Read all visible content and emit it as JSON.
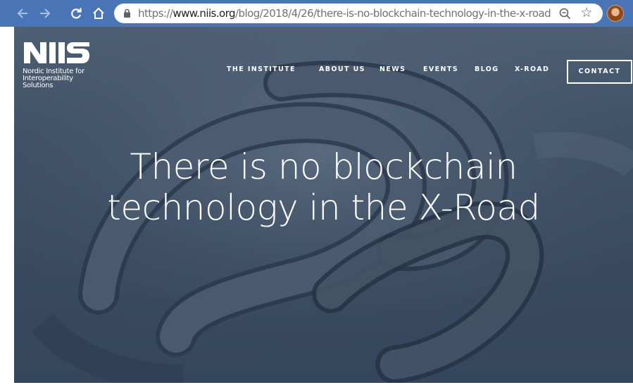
{
  "browser": {
    "back_icon": "arrow-left-icon",
    "forward_icon": "arrow-right-icon",
    "reload_icon": "reload-icon",
    "home_icon": "home-icon",
    "url_scheme": "https://",
    "url_host": "www.niis.org",
    "url_path": "/blog/2018/4/26/there-is-no-blockchain-technology-in-the-x-road",
    "zoom_icon": "zoom-icon",
    "star_icon": "star-icon",
    "avatar_icon": "profile-avatar"
  },
  "site": {
    "logo_text": "NIIS",
    "org_name_line1": "Nordic Institute for",
    "org_name_line2": "Interoperability",
    "org_name_line3": "Solutions",
    "nav": [
      {
        "label": "THE INSTITUTE"
      },
      {
        "label": "ABOUT US"
      },
      {
        "label": "NEWS"
      },
      {
        "label": "EVENTS"
      },
      {
        "label": "BLOG"
      },
      {
        "label": "X-ROAD"
      }
    ],
    "contact_label": "CONTACT"
  },
  "hero": {
    "title_line1": "There is no blockchain",
    "title_line2": "technology in the X-Road",
    "background": "chain-links-binary-image"
  },
  "colors": {
    "browser_bar": "#4a76b8",
    "hero_overlay": "#44566b",
    "text": "#ffffff"
  }
}
